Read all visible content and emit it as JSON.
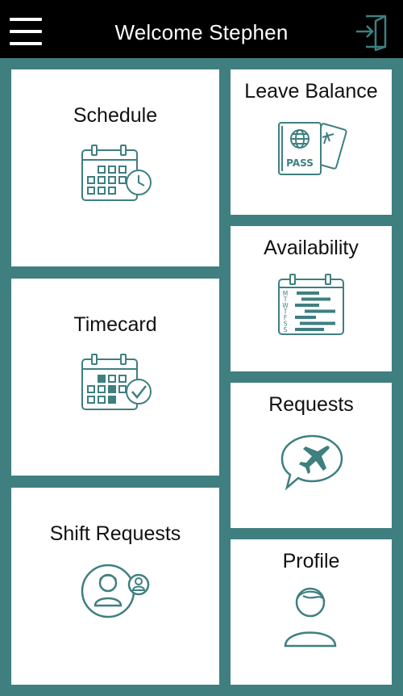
{
  "header": {
    "title": "Welcome Stephen",
    "menu_icon": "hamburger-menu-icon",
    "logout_icon": "logout-door-icon"
  },
  "colors": {
    "background": "#3f7f80",
    "header": "#000000",
    "icon": "#3f7f80",
    "tile": "#ffffff"
  },
  "tiles": {
    "schedule": {
      "label": "Schedule",
      "icon": "calendar-clock-icon"
    },
    "timecard": {
      "label": "Timecard",
      "icon": "calendar-check-icon"
    },
    "shift_requests": {
      "label": "Shift Requests",
      "icon": "user-swap-icon"
    },
    "leave_balance": {
      "label": "Leave Balance",
      "icon": "passport-ticket-icon",
      "pass_text": "PASS"
    },
    "availability": {
      "label": "Availability",
      "icon": "weekly-availability-icon",
      "days": [
        "M",
        "T",
        "W",
        "T",
        "F",
        "S",
        "S"
      ]
    },
    "requests": {
      "label": "Requests",
      "icon": "airplane-speech-bubble-icon"
    },
    "profile": {
      "label": "Profile",
      "icon": "user-profile-icon"
    }
  }
}
